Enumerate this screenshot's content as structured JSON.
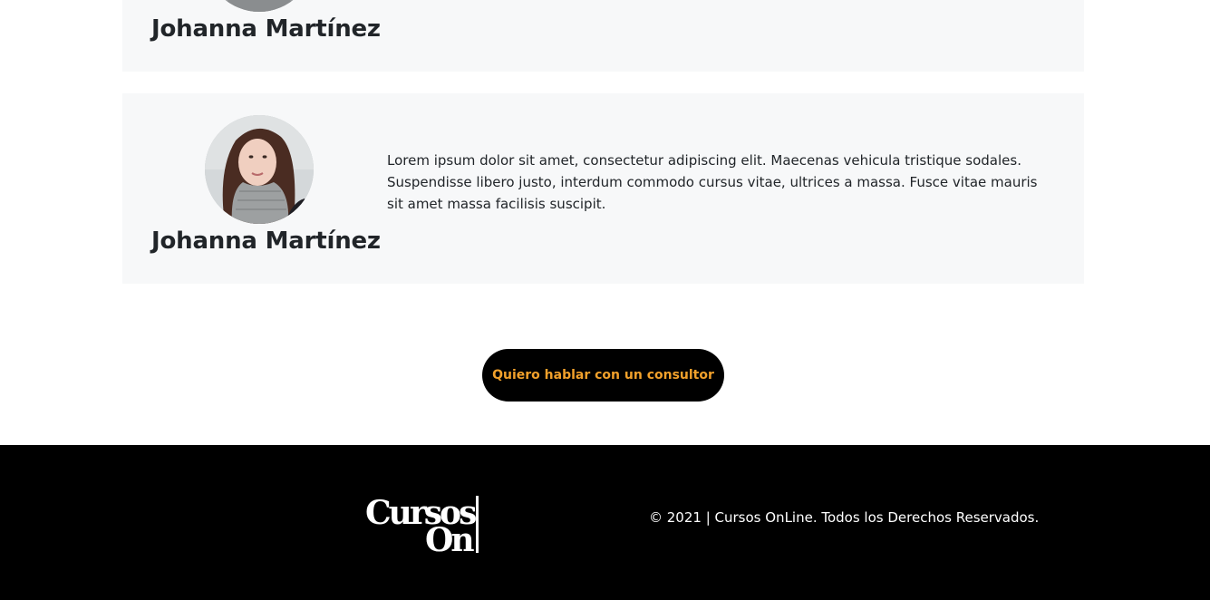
{
  "testimonials": [
    {
      "name": "Johanna Martínez",
      "avatar_icon": "person-avatar"
    },
    {
      "name": "Johanna Martínez",
      "avatar_icon": "person-avatar",
      "text": "Lorem ipsum dolor sit amet, consectetur adipiscing elit. Maecenas vehicula tristique sodales. Suspendisse libero justo, interdum commodo cursus vitae, ultrices a massa. Fusce vitae mauris sit amet massa facilisis suscipit."
    }
  ],
  "cta": {
    "label": "Quiero hablar con un consultor"
  },
  "footer": {
    "logo_line1": "Cursos",
    "logo_line2": "On",
    "copyright": "© 2021 | Cursos OnLine. Todos los Derechos Reservados."
  },
  "colors": {
    "card_background": "#f7f8f9",
    "cta_background": "#000000",
    "cta_text": "#f2a12b",
    "footer_background": "#000000"
  }
}
